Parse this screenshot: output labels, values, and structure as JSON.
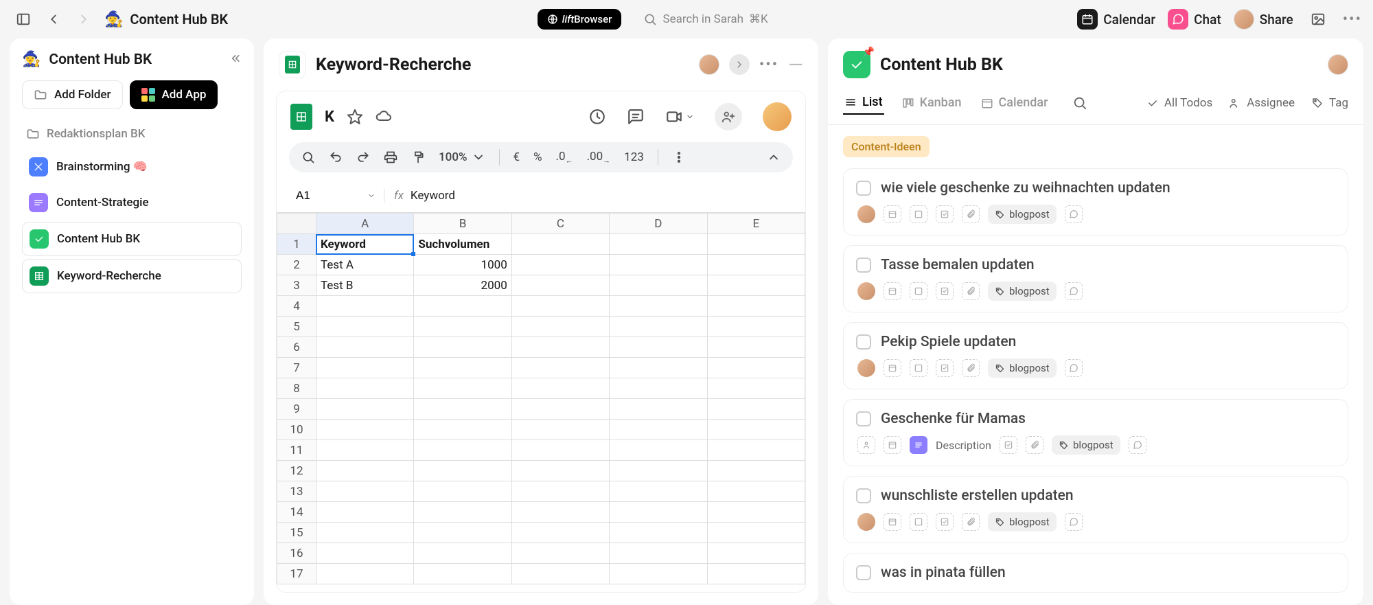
{
  "topbar": {
    "breadcrumb_title": "Content Hub BK",
    "lift_label_italic": "lift",
    "lift_label_rest": "Browser",
    "search_placeholder": "Search in Sarah",
    "search_shortcut": "⌘K",
    "calendar": "Calendar",
    "chat": "Chat",
    "share": "Share"
  },
  "sidebar": {
    "title": "Content Hub BK",
    "add_folder": "Add Folder",
    "add_app": "Add App",
    "section": "Redaktionsplan BK",
    "items": [
      {
        "label": "Brainstorming 🧠",
        "color": "blue"
      },
      {
        "label": "Content-Strategie",
        "color": "purple"
      },
      {
        "label": "Content Hub BK",
        "color": "green"
      },
      {
        "label": "Keyword-Recherche",
        "color": "gsheet"
      }
    ]
  },
  "left_panel": {
    "title": "Keyword-Recherche",
    "sheet": {
      "doc_initial": "K",
      "zoom": "100%",
      "currency": "€",
      "percent": "%",
      "dec_dec": ".0",
      "dec_inc": ".00",
      "nums": "123",
      "cell_ref": "A1",
      "fx_label": "fx",
      "fx_value": "Keyword",
      "columns": [
        "A",
        "B",
        "C",
        "D",
        "E"
      ],
      "rows": [
        "1",
        "2",
        "3",
        "4",
        "5",
        "6",
        "7",
        "8",
        "9",
        "10",
        "11",
        "12",
        "13",
        "14",
        "15",
        "16",
        "17"
      ],
      "header1": "Keyword",
      "header2": "Suchvolumen",
      "r2c1": "Test A",
      "r2c2": "1000",
      "r3c1": "Test B",
      "r3c2": "2000"
    }
  },
  "right_panel": {
    "title": "Content Hub BK",
    "tabs": {
      "list": "List",
      "kanban": "Kanban",
      "calendar": "Calendar"
    },
    "filters": {
      "all_todos": "All Todos",
      "assignee": "Assignee",
      "tag": "Tag"
    },
    "group_label": "Content-Ideen",
    "description_label": "Description",
    "blogpost_tag": "blogpost",
    "tasks": [
      {
        "title": "wie viele geschenke zu weihnachten updaten",
        "has_avatar": true,
        "has_desc": false
      },
      {
        "title": "Tasse bemalen updaten",
        "has_avatar": true,
        "has_desc": false
      },
      {
        "title": "Pekip Spiele updaten",
        "has_avatar": true,
        "has_desc": false
      },
      {
        "title": "Geschenke für Mamas",
        "has_avatar": false,
        "has_desc": true
      },
      {
        "title": "wunschliste erstellen updaten",
        "has_avatar": true,
        "has_desc": false
      },
      {
        "title": "was in pinata füllen",
        "has_avatar": true,
        "has_desc": false,
        "meta_hidden": true
      }
    ]
  }
}
